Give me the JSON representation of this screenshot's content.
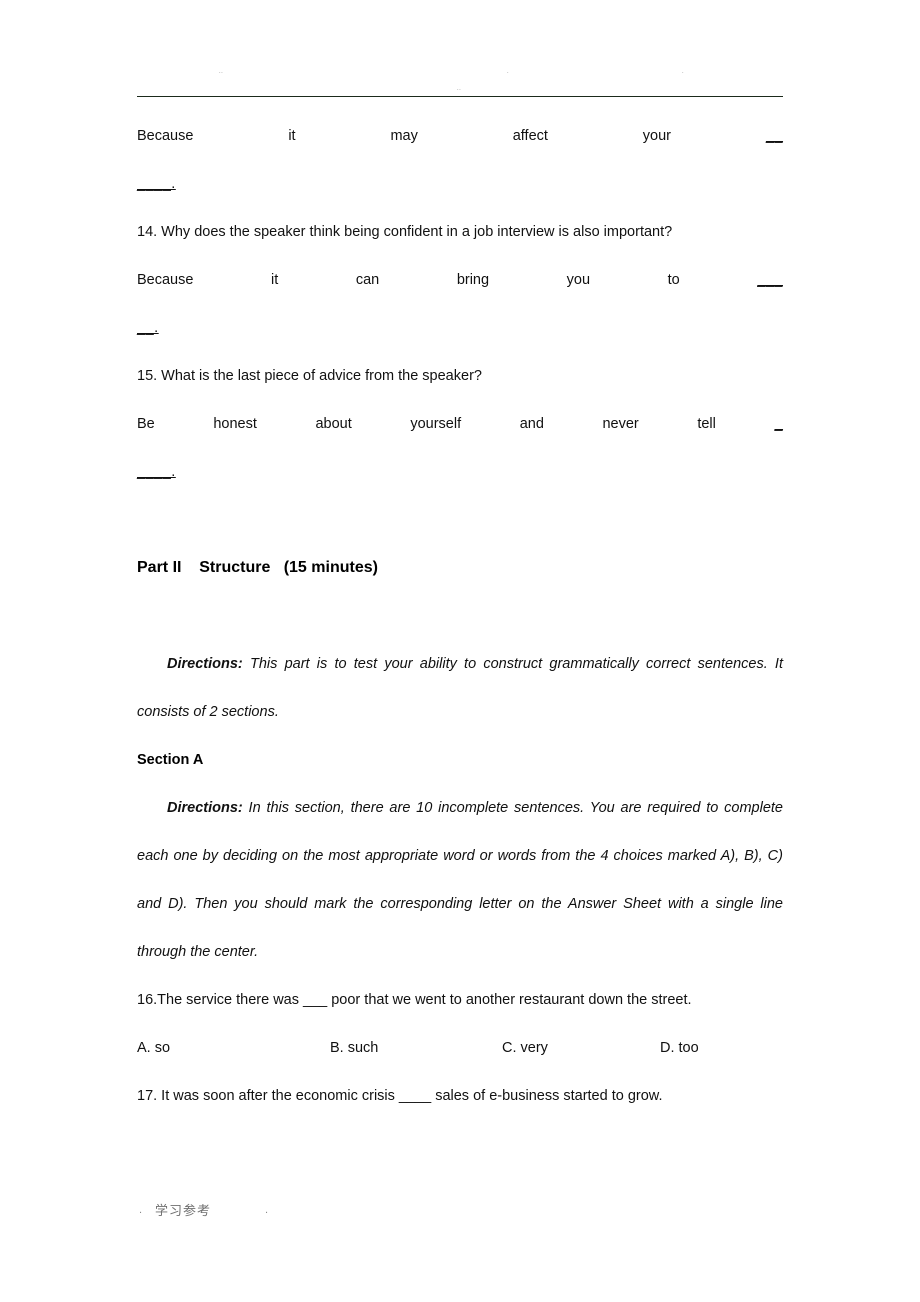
{
  "header": {
    "marks": [
      "··",
      "·",
      "·",
      "··"
    ]
  },
  "listening_answers": {
    "q13_answer_words": [
      "Because",
      "it",
      "may",
      "affect",
      "your"
    ],
    "q13_answer_blank": "__",
    "q13_answer_wrap": "____.",
    "q14_question": "14. Why does the speaker think being confident in a job interview is also important?",
    "q14_answer_words": [
      "Because",
      "it",
      "can",
      "bring",
      "you",
      "to"
    ],
    "q14_answer_blank": "___",
    "q14_answer_wrap": "__.",
    "q15_question": "15. What is the last piece of advice from the speaker?",
    "q15_answer_words": [
      "Be",
      "honest",
      "about",
      "yourself",
      "and",
      "never",
      "tell"
    ],
    "q15_answer_blank": "_",
    "q15_answer_wrap": "____."
  },
  "part": {
    "label": "Part II",
    "title": "Structure",
    "time": "(15 minutes)",
    "heading_full": "Part II    Structure   (15 minutes)"
  },
  "part_directions": {
    "lead": "Directions:",
    "body": " This part is to test your ability to construct grammatically correct sentences. It consists of 2 sections."
  },
  "section_a": {
    "heading": "Section A",
    "directions_lead": "Directions:",
    "directions_body": " In this section, there are 10 incomplete sentences. You are required to complete each one by deciding on the most appropriate word or words from the 4 choices marked A), B), C) and D). Then you should mark the corresponding letter on the Answer Sheet with a single line through the center.",
    "questions": [
      {
        "text": "16.The service there was ___ poor that we went to another restaurant down the street.",
        "choices": [
          "A. so",
          "B. such",
          "C. very",
          "D. too"
        ]
      },
      {
        "text": "17. It was soon after the economic crisis ____ sales of e-business started to grow.",
        "choices": []
      }
    ]
  },
  "footer": {
    "dot_left": ".",
    "text": "学习参考",
    "dot_right": "."
  }
}
